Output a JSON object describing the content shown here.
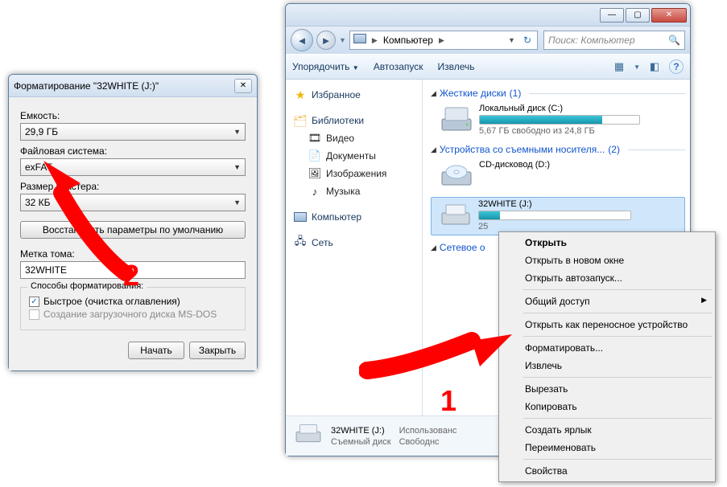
{
  "format_dialog": {
    "title": "Форматирование \"32WHITE (J:)\"",
    "labels": {
      "capacity": "Емкость:",
      "fs": "Файловая система:",
      "cluster": "Размер кластера:",
      "restore_btn": "Восстановить параметры по умолчанию",
      "volume": "Метка тома:",
      "options_group": "Способы форматирования:",
      "quick": "Быстрое (очистка оглавления)",
      "msdos": "Создание загрузочного диска MS-DOS",
      "start": "Начать",
      "close": "Закрыть"
    },
    "values": {
      "capacity": "29,9 ГБ",
      "fs": "exFAT",
      "cluster": "32 КБ",
      "volume": "32WHITE"
    }
  },
  "explorer": {
    "nav": {
      "breadcrumb": "Компьютер",
      "search_placeholder": "Поиск: Компьютер"
    },
    "toolbar": {
      "organize": "Упорядочить",
      "autorun": "Автозапуск",
      "eject": "Извлечь"
    },
    "sidebar": {
      "favorites": "Избранное",
      "libraries": "Библиотеки",
      "video": "Видео",
      "documents": "Документы",
      "pictures": "Изображения",
      "music": "Музыка",
      "computer": "Компьютер",
      "network": "Сеть"
    },
    "groups": {
      "hdd": {
        "label": "Жесткие диски",
        "count": "(1)"
      },
      "removable": {
        "label": "Устройства со съемными носителя...",
        "count": "(2)"
      },
      "netloc": {
        "label": "Сетевое о"
      }
    },
    "drives": {
      "c": {
        "name": "Локальный диск (C:)",
        "free": "5,67 ГБ свободно из 24,8 ГБ",
        "fill_pct": 77
      },
      "d": {
        "name": "CD-дисковод (D:)"
      },
      "j": {
        "name": "32WHITE (J:)",
        "free": "25",
        "fill_pct": 14
      }
    },
    "status": {
      "title": "32WHITE (J:)",
      "subtitle": "Съемный диск",
      "used_k": "Использованс",
      "free_k": "Свободнс"
    }
  },
  "context_menu": {
    "items": {
      "open": "Открыть",
      "open_new": "Открыть в новом окне",
      "open_autorun": "Открыть автозапуск...",
      "sharing": "Общий доступ",
      "portable": "Открыть как переносное устройство",
      "format": "Форматировать...",
      "eject": "Извлечь",
      "cut": "Вырезать",
      "copy": "Копировать",
      "shortcut": "Создать ярлык",
      "rename": "Переименовать",
      "properties": "Свойства"
    }
  },
  "annotations": {
    "one": "1",
    "two": "2"
  }
}
